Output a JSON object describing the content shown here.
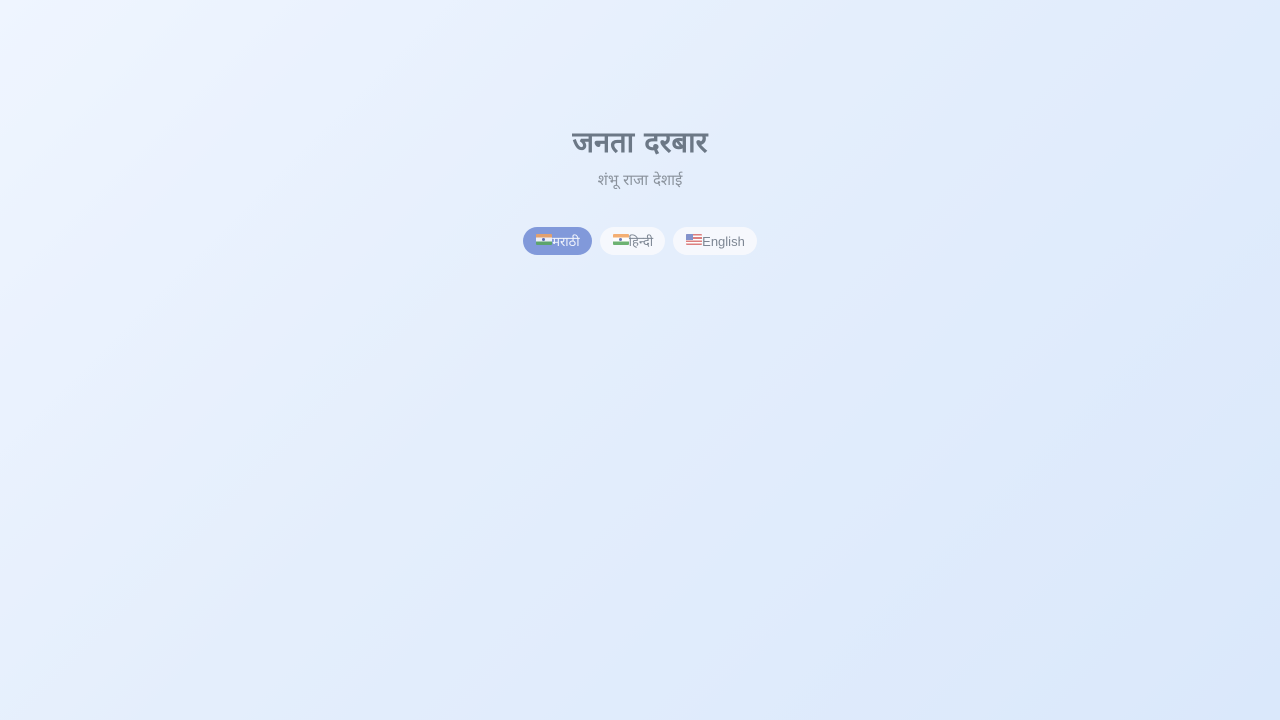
{
  "header": {
    "title": "जनता दरबार",
    "subtitle": "शंभू राजा देशाई"
  },
  "languages": [
    {
      "label": "मराठी",
      "flag": "india-flag-icon",
      "active": true
    },
    {
      "label": "हिन्दी",
      "flag": "india-flag-icon",
      "active": false
    },
    {
      "label": "English",
      "flag": "us-flag-icon",
      "active": false
    }
  ],
  "colors": {
    "background_start": "#eff5ff",
    "background_end": "#dae8fb",
    "active_button": "#8199da",
    "title_text": "#6c7886"
  }
}
